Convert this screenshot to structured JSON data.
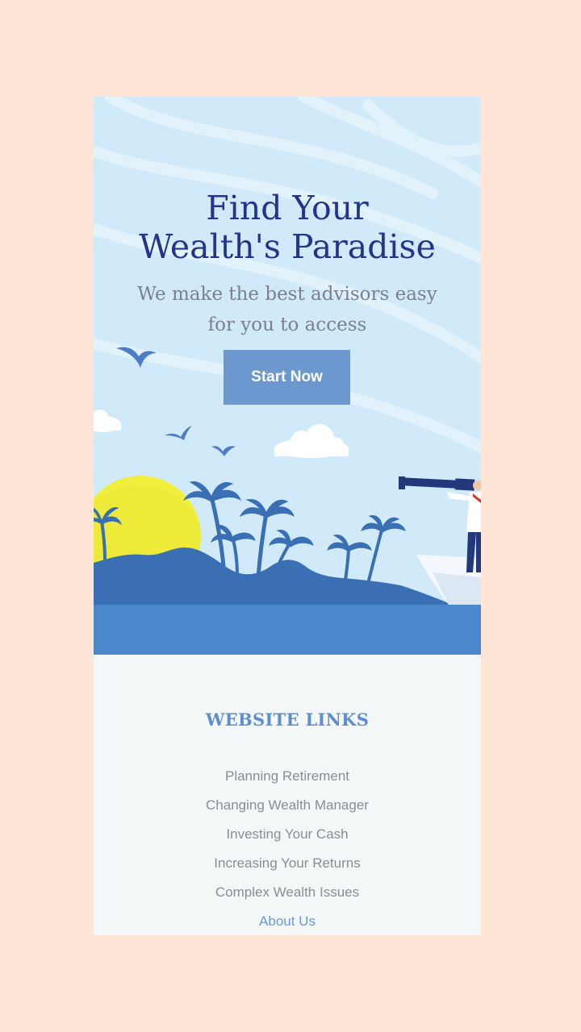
{
  "colors": {
    "page_background": "#fee5d6",
    "sky": "#d0eaf9",
    "title": "#24348a",
    "subtitle": "#7a8091",
    "button": "#6c98cf",
    "sea": "#4a87cb",
    "island": "#3a6fb4",
    "sun": "#f1ef3b",
    "links_background": "#f4f7f8",
    "links_heading": "#5f8ed0",
    "link_text": "#8a8d94",
    "link_active": "#6c98d6"
  },
  "hero": {
    "title_line1": "Find Your",
    "title_line2": "Wealth's Paradise",
    "subtitle_line1": "We make the best advisors easy",
    "subtitle_line2": "for you to access",
    "cta_label": "Start Now",
    "illustration": {
      "elements": [
        "bird-icon",
        "cloud-icon",
        "sun-icon",
        "palm-tree-icon",
        "island-icon",
        "sea",
        "boat-icon",
        "person-with-telescope-icon"
      ]
    }
  },
  "links": {
    "heading": "WEBSITE LINKS",
    "items": [
      {
        "label": "Planning Retirement",
        "active": false
      },
      {
        "label": "Changing Wealth Manager",
        "active": false
      },
      {
        "label": "Investing Your Cash",
        "active": false
      },
      {
        "label": "Increasing Your Returns",
        "active": false
      },
      {
        "label": "Complex Wealth Issues",
        "active": false
      },
      {
        "label": "About Us",
        "active": true
      }
    ]
  }
}
